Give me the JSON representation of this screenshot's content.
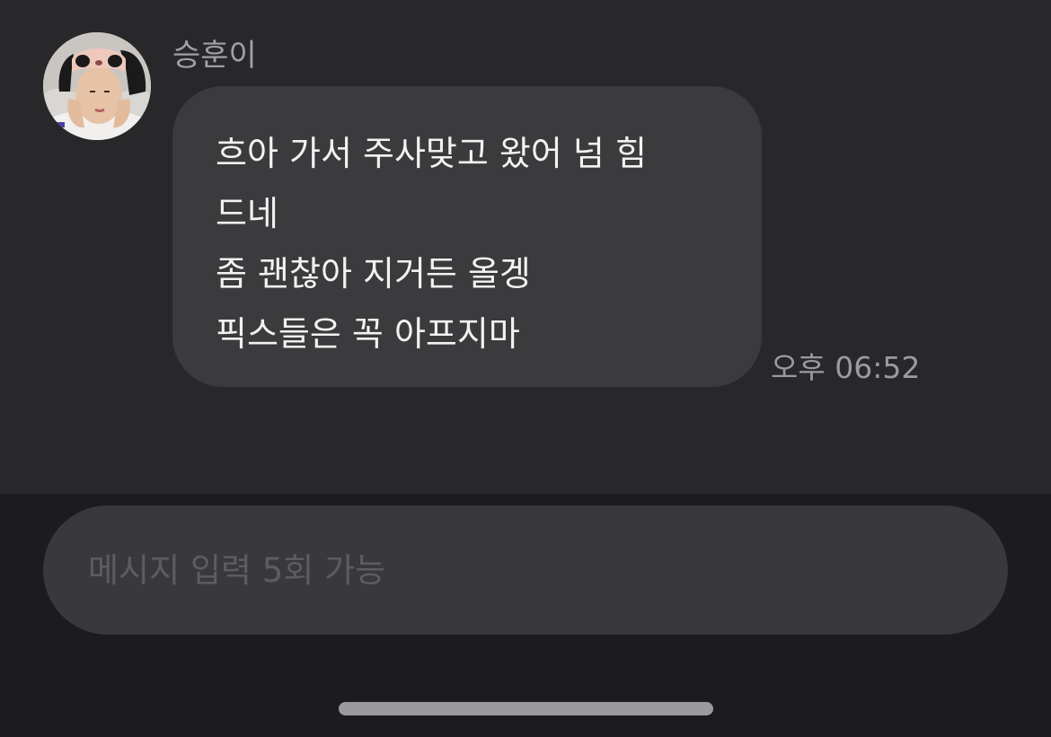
{
  "conversation": {
    "sender_name": "승훈이",
    "avatar_icon": "profile-photo",
    "message": {
      "lines": [
        "흐아 가서 주사맞고 왔어 넘 힘",
        "드네",
        "좀 괜찮아 지거든 올겡",
        "픽스들은 꼭 아프지마"
      ],
      "time": "오후 06:52"
    }
  },
  "composer": {
    "placeholder": "메시지 입력 5회 가능",
    "value": ""
  },
  "theme": {
    "chat_background": "#28282a",
    "page_background": "#1c1c1e",
    "bubble": "#3b3b3e",
    "text": "#f2f2f2",
    "muted_text": "#a0a0a6"
  }
}
